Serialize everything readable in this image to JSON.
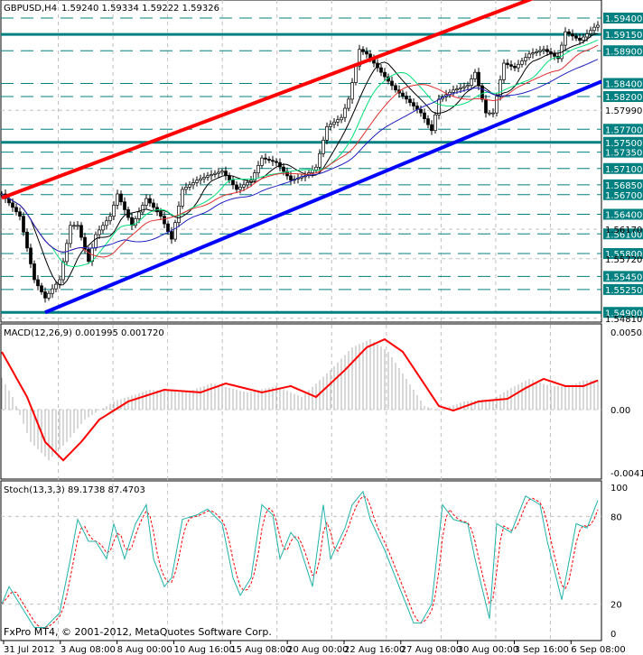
{
  "header": {
    "symbol": "GBPUSD,H4",
    "values": "1.59240 1.59334 1.59222 1.59326"
  },
  "macd_label": "MACD(12,26,9) 0.001995 0.001720",
  "stoch_label": "Stoch(13,3,3) 89.1738 87.4703",
  "copyright": "FxPro MT4, © 2001-2012, MetaQuotes Software Corp.",
  "colors": {
    "level": "#008080",
    "up_trend": "#0000ff",
    "down_trend": "#ff0000",
    "macd_signal": "#ff0000",
    "stoch_main": "#20b2aa",
    "stoch_signal": "#ff0000"
  },
  "price_axis": {
    "min": 1.5481,
    "max": 1.595,
    "level_labels": [
      "1.59400",
      "1.59150",
      "1.58900",
      "1.58400",
      "1.58200",
      "1.57700",
      "1.57500",
      "1.57350",
      "1.57100",
      "1.56850",
      "1.56700",
      "1.56400",
      "1.56100",
      "1.55800",
      "1.55450",
      "1.55250",
      "1.54900"
    ],
    "solid_levels": [
      "1.59150",
      "1.57500",
      "1.54900"
    ],
    "grid_labels": [
      "1.57990",
      "1.56170",
      "1.55720",
      "1.54810"
    ]
  },
  "macd_axis": {
    "labels": [
      "0.00505",
      "0.00",
      "-0.00412"
    ],
    "values": [
      0.00505,
      0,
      -0.00412
    ]
  },
  "stoch_axis": {
    "labels": [
      "100",
      "80",
      "20",
      "0"
    ],
    "values": [
      100,
      80,
      20,
      0
    ]
  },
  "time_axis": [
    "31 Jul 2012",
    "3 Aug 08:00",
    "8 Aug 00:00",
    "10 Aug 16:00",
    "15 Aug 08:00",
    "20 Aug 00:00",
    "22 Aug 16:00",
    "27 Aug 08:00",
    "30 Aug 00:00",
    "3 Sep 16:00",
    "6 Sep 08:00"
  ],
  "chart_data": {
    "type": "candlestick",
    "bars": 166,
    "close_samples": [
      [
        0,
        1.5671
      ],
      [
        5,
        1.5637
      ],
      [
        9,
        1.554
      ],
      [
        12,
        1.5512
      ],
      [
        16,
        1.554
      ],
      [
        19,
        1.5623
      ],
      [
        21,
        1.5623
      ],
      [
        24,
        1.5568
      ],
      [
        26,
        1.5609
      ],
      [
        30,
        1.5637
      ],
      [
        32,
        1.5671
      ],
      [
        36,
        1.5623
      ],
      [
        40,
        1.5664
      ],
      [
        44,
        1.5637
      ],
      [
        47,
        1.5602
      ],
      [
        50,
        1.5678
      ],
      [
        54,
        1.5692
      ],
      [
        57,
        1.5699
      ],
      [
        61,
        1.5706
      ],
      [
        65,
        1.5678
      ],
      [
        69,
        1.5692
      ],
      [
        72,
        1.5726
      ],
      [
        76,
        1.5719
      ],
      [
        80,
        1.5692
      ],
      [
        84,
        1.5699
      ],
      [
        87,
        1.5712
      ],
      [
        90,
        1.5774
      ],
      [
        94,
        1.5788
      ],
      [
        96,
        1.5816
      ],
      [
        99,
        1.5892
      ],
      [
        101,
        1.5885
      ],
      [
        105,
        1.5857
      ],
      [
        109,
        1.583
      ],
      [
        112,
        1.5816
      ],
      [
        116,
        1.5795
      ],
      [
        119,
        1.5768
      ],
      [
        121,
        1.5816
      ],
      [
        125,
        1.583
      ],
      [
        129,
        1.5837
      ],
      [
        131,
        1.5857
      ],
      [
        134,
        1.5795
      ],
      [
        136,
        1.5795
      ],
      [
        139,
        1.5871
      ],
      [
        142,
        1.5864
      ],
      [
        146,
        1.5885
      ],
      [
        150,
        1.5892
      ],
      [
        154,
        1.5878
      ],
      [
        156,
        1.5919
      ],
      [
        160,
        1.5906
      ],
      [
        164,
        1.5926
      ],
      [
        165,
        1.5929
      ]
    ],
    "trendlines": [
      {
        "name": "resistance",
        "color": "#ff0000",
        "from": [
          0,
          1.5665
        ],
        "to": [
          148,
          1.5972
        ]
      },
      {
        "name": "support",
        "color": "#0000ff",
        "from": [
          12,
          1.549
        ],
        "to": [
          166,
          1.5843
        ]
      }
    ],
    "macd_signal": [
      [
        0,
        0.00376
      ],
      [
        7,
        0.00082
      ],
      [
        12,
        -0.0021
      ],
      [
        17,
        -0.0033
      ],
      [
        22,
        -0.0021
      ],
      [
        27,
        -0.00065
      ],
      [
        35,
        0.00053
      ],
      [
        45,
        0.00129
      ],
      [
        55,
        0.00112
      ],
      [
        62,
        0.0017
      ],
      [
        72,
        0.00112
      ],
      [
        80,
        0.00153
      ],
      [
        87,
        0.00082
      ],
      [
        95,
        0.00258
      ],
      [
        101,
        0.00405
      ],
      [
        106,
        0.00458
      ],
      [
        111,
        0.00376
      ],
      [
        116,
        0.002
      ],
      [
        121,
        0.00023
      ],
      [
        125,
        -6e-05
      ],
      [
        132,
        0.00053
      ],
      [
        140,
        0.0007
      ],
      [
        145,
        0.0014
      ],
      [
        150,
        0.002
      ],
      [
        156,
        0.00153
      ],
      [
        161,
        0.00153
      ],
      [
        165,
        0.0019
      ]
    ],
    "stoch_main": [
      [
        0,
        20
      ],
      [
        2,
        32
      ],
      [
        5,
        20
      ],
      [
        9,
        4
      ],
      [
        12,
        4
      ],
      [
        16,
        14
      ],
      [
        19,
        51
      ],
      [
        21,
        78
      ],
      [
        24,
        63
      ],
      [
        26,
        63
      ],
      [
        29,
        51
      ],
      [
        31,
        75
      ],
      [
        34,
        51
      ],
      [
        37,
        75
      ],
      [
        40,
        88
      ],
      [
        42,
        51
      ],
      [
        45,
        32
      ],
      [
        47,
        38
      ],
      [
        50,
        78
      ],
      [
        54,
        81
      ],
      [
        57,
        85
      ],
      [
        61,
        75
      ],
      [
        64,
        38
      ],
      [
        66,
        26
      ],
      [
        69,
        38
      ],
      [
        72,
        88
      ],
      [
        75,
        81
      ],
      [
        77,
        51
      ],
      [
        80,
        69
      ],
      [
        82,
        63
      ],
      [
        86,
        32
      ],
      [
        89,
        88
      ],
      [
        91,
        51
      ],
      [
        95,
        72
      ],
      [
        97,
        88
      ],
      [
        100,
        97
      ],
      [
        102,
        78
      ],
      [
        106,
        57
      ],
      [
        110,
        32
      ],
      [
        114,
        7
      ],
      [
        116,
        7
      ],
      [
        119,
        20
      ],
      [
        122,
        88
      ],
      [
        125,
        78
      ],
      [
        129,
        75
      ],
      [
        131,
        51
      ],
      [
        135,
        10
      ],
      [
        137,
        75
      ],
      [
        141,
        69
      ],
      [
        145,
        94
      ],
      [
        149,
        88
      ],
      [
        151,
        63
      ],
      [
        155,
        23
      ],
      [
        159,
        75
      ],
      [
        162,
        72
      ],
      [
        165,
        91
      ]
    ]
  }
}
